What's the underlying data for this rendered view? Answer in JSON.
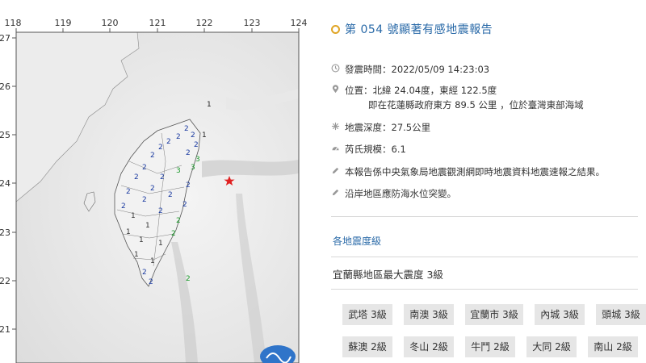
{
  "map": {
    "lon_ticks": [
      "118",
      "119",
      "120",
      "121",
      "122",
      "123",
      "124"
    ],
    "lat_ticks": [
      "27",
      "26",
      "25",
      "24",
      "23",
      "22",
      "21"
    ],
    "intensity_marks": {
      "north_1": "1",
      "east_1": "1"
    }
  },
  "report": {
    "title": "第 054 號顯著有感地震報告",
    "time_label": "發震時間：2022/05/09 14:23:03",
    "location_line1": "位置：北緯 24.04度，東經 122.5度",
    "location_line2": "即在花蓮縣政府東方 89.5 公里 ，位於臺灣東部海域",
    "depth_label": "地震深度：27.5公里",
    "magnitude_label": "芮氏規模：6.1",
    "note1": "本報告係中央氣象局地震觀測網即時地震資料地震速報之結果。",
    "note2": "沿岸地區應防海水位突變。"
  },
  "intensity": {
    "section_label": "各地震度級",
    "max_text": "宜蘭縣地區最大震度 3級",
    "stations": [
      {
        "label": "武塔 3級"
      },
      {
        "label": "南澳 3級"
      },
      {
        "label": "宜蘭市 3級"
      },
      {
        "label": "內城 3級"
      },
      {
        "label": "頭城 3級"
      },
      {
        "label": "蘇澳 2級"
      },
      {
        "label": "冬山 2級"
      },
      {
        "label": "牛鬥 2級"
      },
      {
        "label": "大同 2級"
      },
      {
        "label": "南山 2級"
      }
    ]
  },
  "colors": {
    "accent": "#2a6aa8",
    "epicenter": "#e02020",
    "tag_bg": "#e6e6e6"
  }
}
